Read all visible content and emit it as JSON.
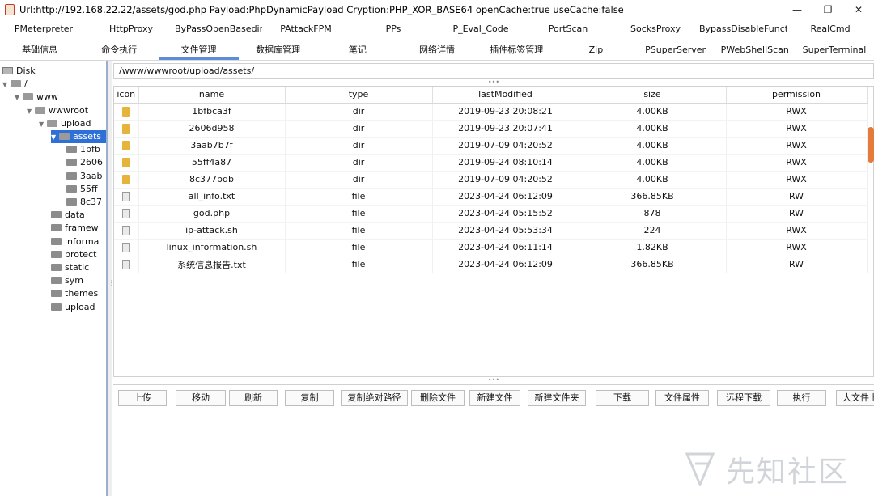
{
  "window": {
    "title": "Url:http://192.168.22.22/assets/god.php Payload:PhpDynamicPayload Cryption:PHP_XOR_BASE64 openCache:true useCache:false",
    "buttons": [
      "—",
      "❐",
      "✕"
    ]
  },
  "tabs_row1": [
    "PMeterpreter",
    "HttpProxy",
    "ByPassOpenBasedir",
    "PAttackFPM",
    "PPs",
    "P_Eval_Code",
    "PortScan",
    "SocksProxy",
    "BypassDisableFunctions",
    "RealCmd"
  ],
  "tabs_row2": [
    "基础信息",
    "命令执行",
    "文件管理",
    "数据库管理",
    "笔记",
    "网络详情",
    "插件标签管理",
    "Zip",
    "PSuperServer",
    "PWebShellScan",
    "SuperTerminal"
  ],
  "active_tab": "文件管理",
  "tree": [
    {
      "label": "Disk",
      "type": "disk"
    },
    {
      "label": "/",
      "type": "folder"
    },
    {
      "label": "www",
      "type": "folder"
    },
    {
      "label": "wwwroot",
      "type": "folder"
    },
    {
      "label": "upload",
      "type": "folder"
    },
    {
      "label": "assets",
      "type": "folder",
      "selected": true
    },
    {
      "label": "1bfb",
      "type": "folder"
    },
    {
      "label": "2606",
      "type": "folder"
    },
    {
      "label": "3aab",
      "type": "folder"
    },
    {
      "label": "55ff",
      "type": "folder"
    },
    {
      "label": "8c37",
      "type": "folder"
    },
    {
      "label": "data",
      "type": "folder"
    },
    {
      "label": "framew",
      "type": "folder"
    },
    {
      "label": "informa",
      "type": "folder"
    },
    {
      "label": "protect",
      "type": "folder"
    },
    {
      "label": "static",
      "type": "folder"
    },
    {
      "label": "sym",
      "type": "folder"
    },
    {
      "label": "themes",
      "type": "folder"
    },
    {
      "label": "upload",
      "type": "folder"
    }
  ],
  "path": "/www/wwwroot/upload/assets/",
  "table": {
    "headers": [
      "icon",
      "name",
      "type",
      "lastModified",
      "size",
      "permission"
    ],
    "rows": [
      {
        "icon": "folder-icon",
        "name": "1bfbca3f",
        "type": "dir",
        "lastModified": "2019-09-23 20:08:21",
        "size": "4.00KB",
        "permission": "RWX"
      },
      {
        "icon": "folder-icon",
        "name": "2606d958",
        "type": "dir",
        "lastModified": "2019-09-23 20:07:41",
        "size": "4.00KB",
        "permission": "RWX"
      },
      {
        "icon": "folder-icon",
        "name": "3aab7b7f",
        "type": "dir",
        "lastModified": "2019-07-09 04:20:52",
        "size": "4.00KB",
        "permission": "RWX"
      },
      {
        "icon": "folder-icon",
        "name": "55ff4a87",
        "type": "dir",
        "lastModified": "2019-09-24 08:10:14",
        "size": "4.00KB",
        "permission": "RWX"
      },
      {
        "icon": "folder-icon",
        "name": "8c377bdb",
        "type": "dir",
        "lastModified": "2019-07-09 04:20:52",
        "size": "4.00KB",
        "permission": "RWX"
      },
      {
        "icon": "file-icon",
        "name": "all_info.txt",
        "type": "file",
        "lastModified": "2023-04-24 06:12:09",
        "size": "366.85KB",
        "permission": "RW"
      },
      {
        "icon": "file-icon",
        "name": "god.php",
        "type": "file",
        "lastModified": "2023-04-24 05:15:52",
        "size": "878",
        "permission": "RW"
      },
      {
        "icon": "file-icon",
        "name": "ip-attack.sh",
        "type": "file",
        "lastModified": "2023-04-24 05:53:34",
        "size": "224",
        "permission": "RWX"
      },
      {
        "icon": "file-icon",
        "name": "linux_information.sh",
        "type": "file",
        "lastModified": "2023-04-24 06:11:14",
        "size": "1.82KB",
        "permission": "RWX"
      },
      {
        "icon": "file-icon",
        "name": "系统信息报告.txt",
        "type": "file",
        "lastModified": "2023-04-24 06:12:09",
        "size": "366.85KB",
        "permission": "RW"
      }
    ]
  },
  "actions": [
    "上传",
    "移动",
    "刷新",
    "复制",
    "复制绝对路径",
    "删除文件",
    "新建文件",
    "新建文件夹",
    "下载",
    "文件属性",
    "远程下载",
    "执行",
    "大文件上"
  ],
  "watermark": "先知社区",
  "colors": {
    "selection": "#2f6fd8",
    "active_tab_underline": "#5b8ed6",
    "scrollbar_thumb": "#e57a3a"
  }
}
